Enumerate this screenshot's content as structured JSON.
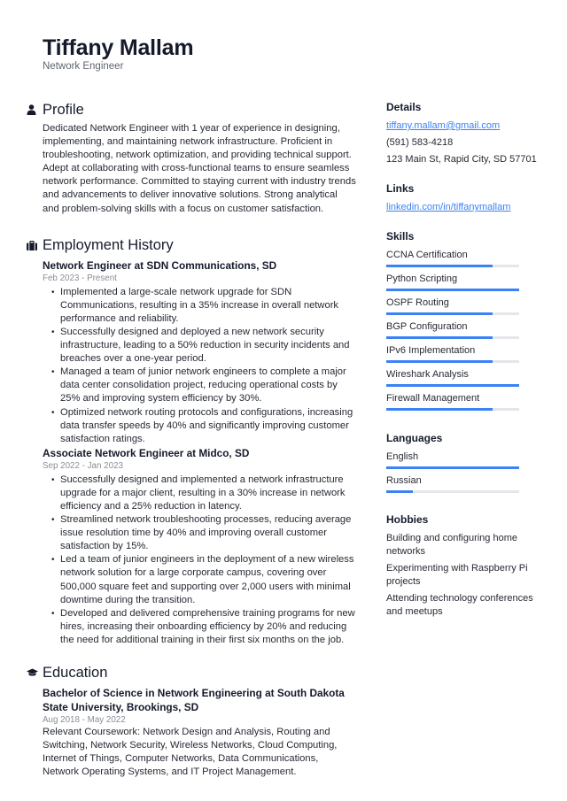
{
  "header": {
    "name": "Tiffany Mallam",
    "title": "Network Engineer"
  },
  "profile": {
    "heading": "Profile",
    "icon": "person-icon",
    "text": "Dedicated Network Engineer with 1 year of experience in designing, implementing, and maintaining network infrastructure. Proficient in troubleshooting, network optimization, and providing technical support. Adept at collaborating with cross-functional teams to ensure seamless network performance. Committed to staying current with industry trends and advancements to deliver innovative solutions. Strong analytical and problem-solving skills with a focus on customer satisfaction."
  },
  "employment": {
    "heading": "Employment History",
    "icon": "briefcase-icon",
    "jobs": [
      {
        "title": "Network Engineer at SDN Communications, SD",
        "dates": "Feb 2023 - Present",
        "bullets": [
          "Implemented a large-scale network upgrade for SDN Communications, resulting in a 35% increase in overall network performance and reliability.",
          "Successfully designed and deployed a new network security infrastructure, leading to a 50% reduction in security incidents and breaches over a one-year period.",
          "Managed a team of junior network engineers to complete a major data center consolidation project, reducing operational costs by 25% and improving system efficiency by 30%.",
          "Optimized network routing protocols and configurations, increasing data transfer speeds by 40% and significantly improving customer satisfaction ratings."
        ]
      },
      {
        "title": "Associate Network Engineer at Midco, SD",
        "dates": "Sep 2022 - Jan 2023",
        "bullets": [
          "Successfully designed and implemented a network infrastructure upgrade for a major client, resulting in a 30% increase in network efficiency and a 25% reduction in latency.",
          "Streamlined network troubleshooting processes, reducing average issue resolution time by 40% and improving overall customer satisfaction by 15%.",
          "Led a team of junior engineers in the deployment of a new wireless network solution for a large corporate campus, covering over 500,000 square feet and supporting over 2,000 users with minimal downtime during the transition.",
          "Developed and delivered comprehensive training programs for new hires, increasing their onboarding efficiency by 20% and reducing the need for additional training in their first six months on the job."
        ]
      }
    ]
  },
  "education": {
    "heading": "Education",
    "icon": "graduation-cap-icon",
    "items": [
      {
        "title": "Bachelor of Science in Network Engineering at South Dakota State University, Brookings, SD",
        "dates": "Aug 2018 - May 2022",
        "text": "Relevant Coursework: Network Design and Analysis, Routing and Switching, Network Security, Wireless Networks, Cloud Computing, Internet of Things, Computer Networks, Data Communications, Network Operating Systems, and IT Project Management."
      }
    ]
  },
  "details": {
    "heading": "Details",
    "email": "tiffany.mallam@gmail.com",
    "phone": "(591) 583-4218",
    "address": "123 Main St, Rapid City, SD 57701"
  },
  "links": {
    "heading": "Links",
    "items": [
      "linkedin.com/in/tiffanymallam"
    ]
  },
  "skills": {
    "heading": "Skills",
    "items": [
      {
        "label": "CCNA Certification",
        "level": 0.8
      },
      {
        "label": "Python Scripting",
        "level": 1.0
      },
      {
        "label": "OSPF Routing",
        "level": 0.8
      },
      {
        "label": "BGP Configuration",
        "level": 0.8
      },
      {
        "label": "IPv6 Implementation",
        "level": 0.8
      },
      {
        "label": "Wireshark Analysis",
        "level": 1.0
      },
      {
        "label": "Firewall Management",
        "level": 0.8
      }
    ]
  },
  "languages": {
    "heading": "Languages",
    "items": [
      {
        "label": "English",
        "level": 1.0
      },
      {
        "label": "Russian",
        "level": 0.2
      }
    ]
  },
  "hobbies": {
    "heading": "Hobbies",
    "items": [
      "Building and configuring home networks",
      "Experimenting with Raspberry Pi projects",
      "Attending technology conferences and meetups"
    ]
  },
  "colors": {
    "accent": "#3b82f6",
    "track": "#e4e6ea",
    "heading": "#151a2b",
    "muted": "#8a8e96"
  }
}
